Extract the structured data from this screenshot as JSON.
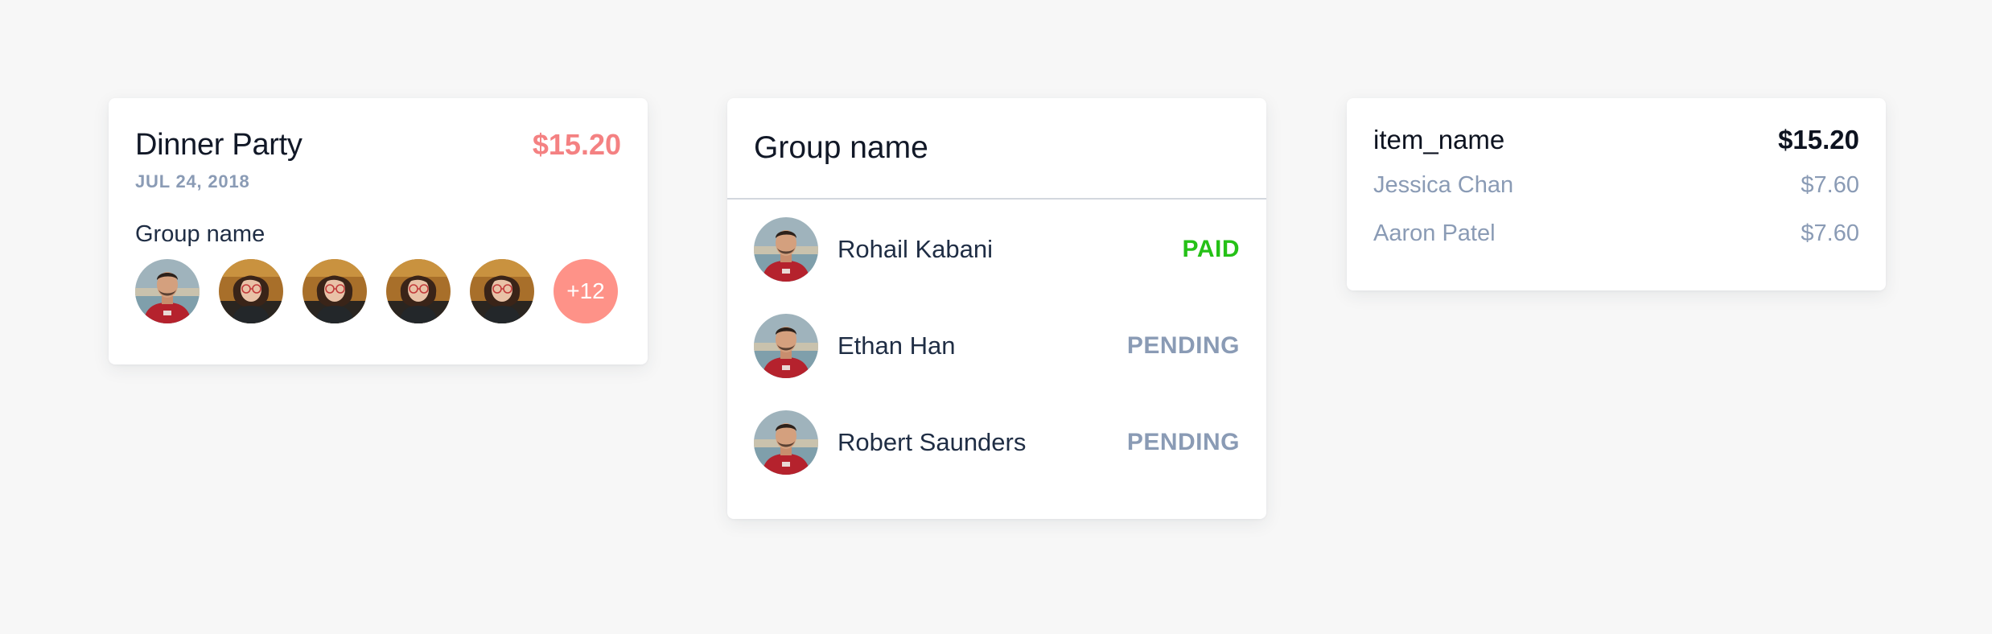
{
  "event_card": {
    "title": "Dinner Party",
    "amount": "$15.20",
    "date": "JUL 24, 2018",
    "group_label": "Group name",
    "avatars": [
      "man-avatar",
      "woman-avatar",
      "woman-avatar",
      "woman-avatar",
      "woman-avatar"
    ],
    "more_count": "+12"
  },
  "group_card": {
    "title": "Group name",
    "members": [
      {
        "name": "Rohail Kabani",
        "status": "PAID"
      },
      {
        "name": "Ethan Han",
        "status": "PENDING"
      },
      {
        "name": "Robert Saunders",
        "status": "PENDING"
      }
    ]
  },
  "item_card": {
    "name": "item_name",
    "price": "$15.20",
    "splits": [
      {
        "name": "Jessica Chan",
        "amount": "$7.60"
      },
      {
        "name": "Aaron Patel",
        "amount": "$7.60"
      }
    ]
  },
  "colors": {
    "background": "#f7f7f7",
    "amount_accent": "#f48182",
    "badge": "#fe9288",
    "paid": "#25c117",
    "muted": "#8a9bb5",
    "text_dark": "#1f2d44"
  }
}
